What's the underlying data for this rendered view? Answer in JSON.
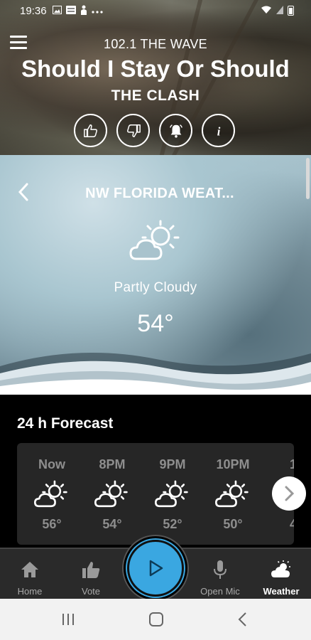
{
  "status_bar": {
    "time": "19:36",
    "notification_icons": [
      "image-icon",
      "station-badge-icon",
      "person-icon",
      "more-dots-icon"
    ],
    "right_icons": [
      "wifi-icon",
      "signal-icon",
      "battery-icon"
    ]
  },
  "now_playing": {
    "station": "102.1 THE WAVE",
    "song": "Should I Stay Or Should",
    "artist": "THE CLASH",
    "actions": [
      "thumbs-up-icon",
      "thumbs-down-icon",
      "alarm-bell-icon",
      "info-icon"
    ]
  },
  "weather": {
    "location": "NW FLORIDA WEAT...",
    "condition": "Partly Cloudy",
    "temperature": "54°",
    "icon": "partly-cloudy-icon"
  },
  "forecast": {
    "title": "24 h Forecast",
    "hours": [
      {
        "hour": "Now",
        "temp": "56°",
        "icon": "partly-cloudy-icon"
      },
      {
        "hour": "8PM",
        "temp": "54°",
        "icon": "partly-cloudy-icon"
      },
      {
        "hour": "9PM",
        "temp": "52°",
        "icon": "partly-cloudy-icon"
      },
      {
        "hour": "10PM",
        "temp": "50°",
        "icon": "partly-cloudy-icon"
      },
      {
        "hour": "1",
        "temp": "4",
        "icon": "partly-cloudy-icon"
      }
    ]
  },
  "bottom_nav": {
    "items": [
      {
        "label": "Home",
        "icon": "home-icon"
      },
      {
        "label": "Vote",
        "icon": "thumbs-up-icon"
      },
      {
        "label": "Open Mic",
        "icon": "microphone-icon"
      },
      {
        "label": "Weather",
        "icon": "weather-cloud-icon",
        "active": true
      }
    ],
    "play_icon": "play-icon",
    "accent_color": "#3aa7e1"
  },
  "system_nav": [
    "recent-apps-icon",
    "home-circle-icon",
    "back-chevron-icon"
  ]
}
